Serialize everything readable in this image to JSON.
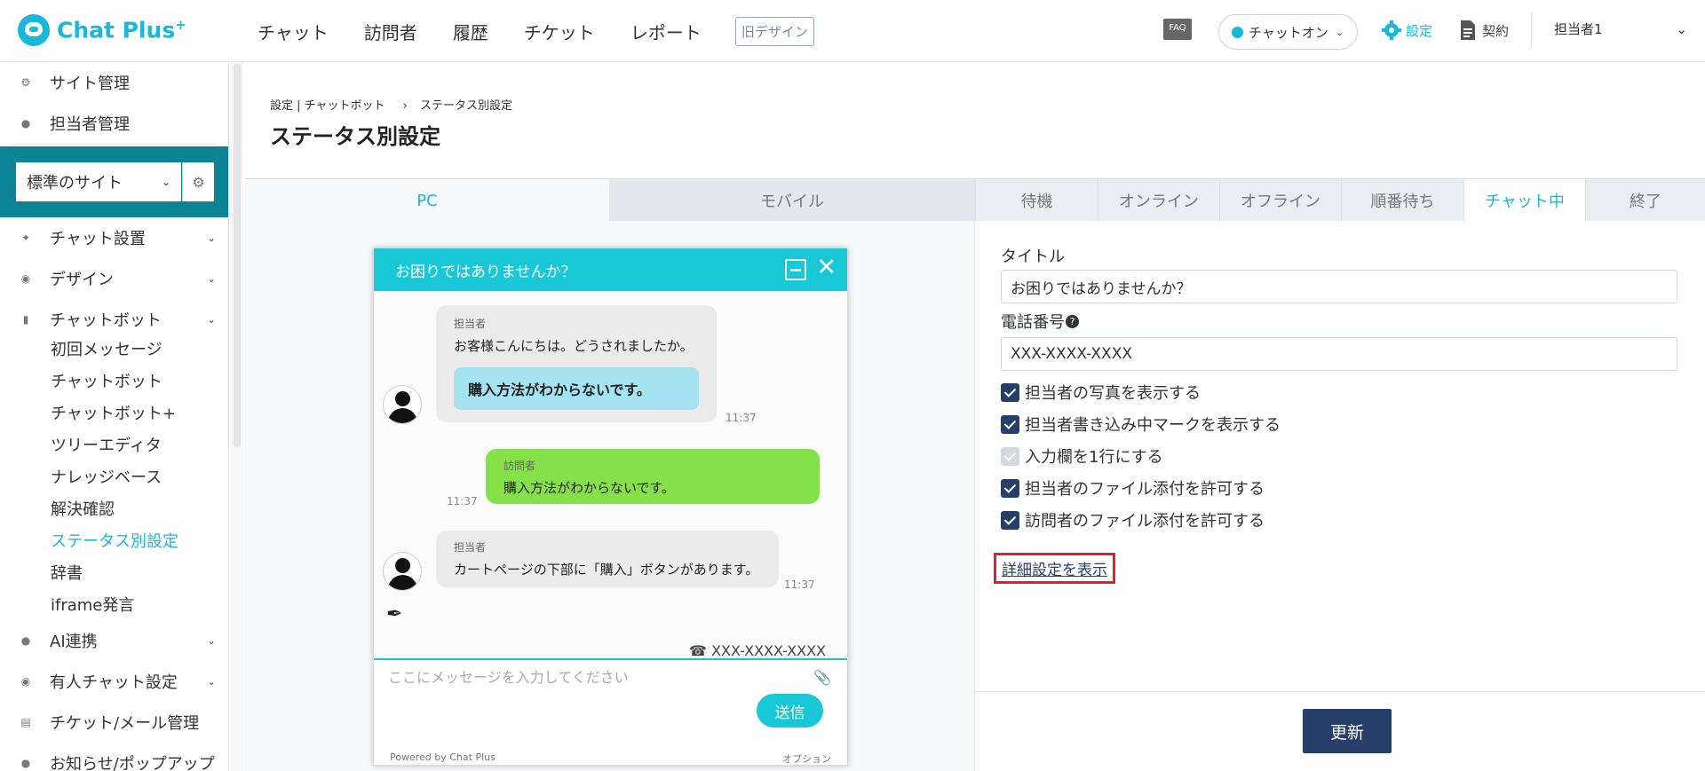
{
  "app": {
    "logo_text": "Chat Plus",
    "logo_sup": "+"
  },
  "topnav": {
    "items": [
      "チャット",
      "訪問者",
      "履歴",
      "チケット",
      "レポート"
    ],
    "old_design": "旧デザイン"
  },
  "header": {
    "faq": "FAQ",
    "chat_status": "チャットオン",
    "settings": "設定",
    "contract": "契約",
    "user": "担当者1"
  },
  "sidebar": {
    "top_items": [
      "サイト管理",
      "担当者管理"
    ],
    "site_select": "標準のサイト",
    "items": [
      "チャット設置",
      "デザイン",
      "チャットボット"
    ],
    "chatbot_subitems": [
      "初回メッセージ",
      "チャットボット",
      "チャットボット+",
      "ツリーエディタ",
      "ナレッジベース",
      "解決確認",
      "ステータス別設定",
      "辞書",
      "iframe発言"
    ],
    "active_subitem": "ステータス別設定",
    "bottom_items": [
      "AI連携",
      "有人チャット設定",
      "チケット/メール管理",
      "お知らせ/ポップアップ"
    ]
  },
  "page": {
    "breadcrumb": [
      "設定 | チャットボット",
      "›",
      "ステータス別設定"
    ],
    "title": "ステータス別設定"
  },
  "tabs": {
    "platform": [
      "PC",
      "モバイル"
    ],
    "status": [
      "待機",
      "オンライン",
      "オフライン",
      "順番待ち",
      "チャット中",
      "終了"
    ],
    "active_platform": "PC",
    "active_status": "チャット中"
  },
  "preview": {
    "header_title": "お困りではありませんか？",
    "msg1_name": "担当者",
    "msg1_text": "お客様こんにちは。どうされましたか。",
    "msg1_quick": "購入方法がわからないです。",
    "msg1_time": "11:37",
    "msg2_name": "訪問者",
    "msg2_text": "購入方法がわからないです。",
    "msg2_time": "11:37",
    "msg3_name": "担当者",
    "msg3_text": "カートページの下部に「購入」ボタンがあります。",
    "msg3_time": "11:37",
    "phone": "XXX-XXXX-XXXX",
    "input_placeholder": "ここにメッセージを入力してください",
    "send": "送信",
    "powered": "Powered by Chat Plus",
    "option": "オプション"
  },
  "form": {
    "title_label": "タイトル",
    "title_value": "お困りではありませんか？",
    "phone_label": "電話番号",
    "phone_value": "XXX-XXXX-XXXX",
    "checkboxes": [
      {
        "label": "担当者の写真を表示する",
        "checked": true
      },
      {
        "label": "担当者書き込み中マークを表示する",
        "checked": true
      },
      {
        "label": "入力欄を1行にする",
        "checked": true,
        "disabled": true
      },
      {
        "label": "担当者のファイル添付を許可する",
        "checked": true
      },
      {
        "label": "訪問者のファイル添付を許可する",
        "checked": true
      }
    ],
    "detail_link": "詳細設定を表示",
    "update": "更新"
  },
  "colors": {
    "accent": "#19b8d8",
    "navy": "#27406b",
    "sidebar_site": "#0b8596",
    "highlight": "#d9232e"
  }
}
